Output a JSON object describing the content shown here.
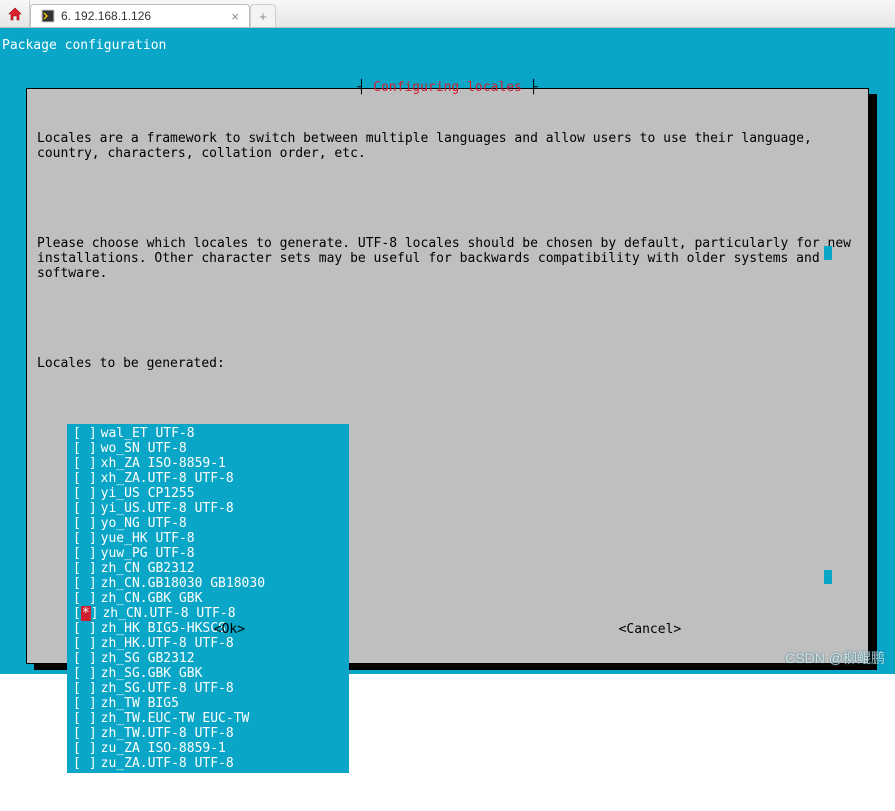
{
  "browser": {
    "tab_title": "6. 192.168.1.126",
    "close_glyph": "×",
    "newtab_glyph": "+"
  },
  "terminal": {
    "header": "Package configuration"
  },
  "dialog": {
    "title": "Configuring locales",
    "para1": "Locales are a framework to switch between multiple languages and allow users to use their language, country, characters, collation order, etc.",
    "para2": "Please choose which locales to generate. UTF-8 locales should be chosen by default, particularly for new installations. Other character sets may be useful for backwards compatibility with older systems and software.",
    "prompt": "Locales to be generated:",
    "ok_label": "<Ok>",
    "cancel_label": "<Cancel>"
  },
  "locales": [
    {
      "label": "wal_ET UTF-8",
      "checked": false,
      "selected": false
    },
    {
      "label": "wo_SN UTF-8",
      "checked": false,
      "selected": false
    },
    {
      "label": "xh_ZA ISO-8859-1",
      "checked": false,
      "selected": false
    },
    {
      "label": "xh_ZA.UTF-8 UTF-8",
      "checked": false,
      "selected": false
    },
    {
      "label": "yi_US CP1255",
      "checked": false,
      "selected": false
    },
    {
      "label": "yi_US.UTF-8 UTF-8",
      "checked": false,
      "selected": false
    },
    {
      "label": "yo_NG UTF-8",
      "checked": false,
      "selected": false
    },
    {
      "label": "yue_HK UTF-8",
      "checked": false,
      "selected": false
    },
    {
      "label": "yuw_PG UTF-8",
      "checked": false,
      "selected": false
    },
    {
      "label": "zh_CN GB2312",
      "checked": false,
      "selected": false
    },
    {
      "label": "zh_CN.GB18030 GB18030",
      "checked": false,
      "selected": false
    },
    {
      "label": "zh_CN.GBK GBK",
      "checked": false,
      "selected": false
    },
    {
      "label": "zh_CN.UTF-8 UTF-8",
      "checked": true,
      "selected": true
    },
    {
      "label": "zh_HK BIG5-HKSCS",
      "checked": false,
      "selected": false
    },
    {
      "label": "zh_HK.UTF-8 UTF-8",
      "checked": false,
      "selected": false
    },
    {
      "label": "zh_SG GB2312",
      "checked": false,
      "selected": false
    },
    {
      "label": "zh_SG.GBK GBK",
      "checked": false,
      "selected": false
    },
    {
      "label": "zh_SG.UTF-8 UTF-8",
      "checked": false,
      "selected": false
    },
    {
      "label": "zh_TW BIG5",
      "checked": false,
      "selected": false
    },
    {
      "label": "zh_TW.EUC-TW EUC-TW",
      "checked": false,
      "selected": false
    },
    {
      "label": "zh_TW.UTF-8 UTF-8",
      "checked": false,
      "selected": false
    },
    {
      "label": "zu_ZA ISO-8859-1",
      "checked": false,
      "selected": false
    },
    {
      "label": "zu_ZA.UTF-8 UTF-8",
      "checked": false,
      "selected": false
    }
  ],
  "watermark": "CSDN @柳鲲鹏"
}
